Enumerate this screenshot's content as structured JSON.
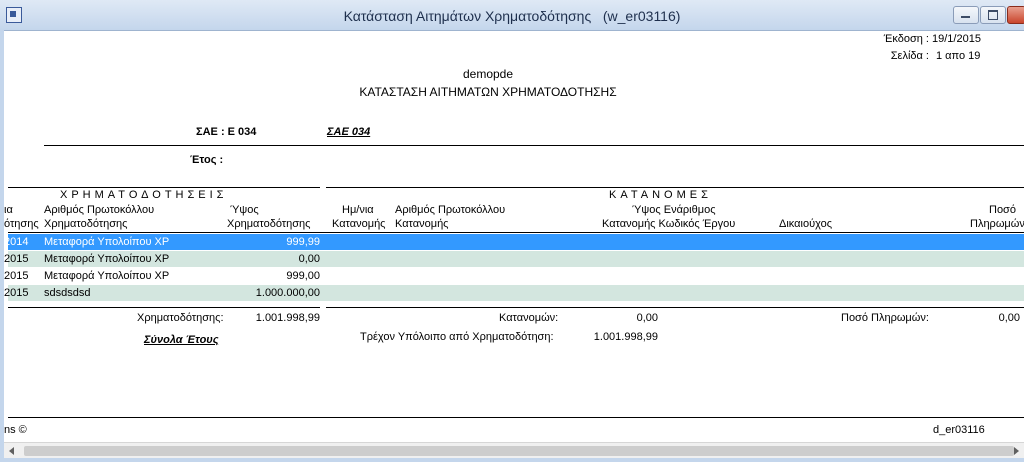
{
  "window": {
    "title": "Κατάσταση Αιτημάτων Χρηματοδότησης   (w_er03116)"
  },
  "report": {
    "edition_label": "Έκδοση :",
    "edition_value": "19/1/2015",
    "page_label": "Σελίδα :",
    "page_value": "1 απο 19",
    "company": "demopde",
    "title": "ΚΑΤΑΣΤΑΣΗ ΑΙΤΗΜΑΤΩΝ ΧΡΗΜΑΤΟΔΟΤΗΣΗΣ",
    "sae_label": "ΣΑΕ : Ε 034",
    "sae_link": "ΣΑΕ 034",
    "year_label": "Έτος :"
  },
  "headers": {
    "funding_group": "ΧΡΗΜΑΤΟΔΟΤΗΣΕΙΣ",
    "allocation_group": "ΚΑΤΑΝΟΜΕΣ",
    "col_date_1": "ια",
    "col_date_2": "ότησης",
    "col_protocol_1": "Αριθμός Πρωτοκόλλου",
    "col_protocol_2": "Χρηματοδότησης",
    "col_amount_1": "Ύψος",
    "col_amount_2": "Χρηματοδότησης",
    "col_alloc_date_1": "Ημ/νια",
    "col_alloc_date_2": "Κατανομής",
    "col_alloc_protocol_1": "Αριθμός Πρωτοκόλλου",
    "col_alloc_protocol_2": "Κατανομής",
    "col_alloc_amount_1": "Ύψος Ενάριθμος",
    "col_alloc_amount_2": "Κατανομής Κωδικός Έργου",
    "col_beneficiary": "Δικαιούχος",
    "col_payment_1": "Ποσό",
    "col_payment_2": "Πληρωμών"
  },
  "rows": [
    {
      "date": "2014",
      "protocol": "Μεταφορά Υπολοίπου ΧΡ",
      "amount": "999,99"
    },
    {
      "date": "2015",
      "protocol": "Μεταφορά Υπολοίπου ΧΡ",
      "amount": "0,00"
    },
    {
      "date": "2015",
      "protocol": "Μεταφορά Υπολοίπου ΧΡ",
      "amount": "999,00"
    },
    {
      "date": "2015",
      "protocol": "sdsdsdsd",
      "amount": "1.000.000,00"
    }
  ],
  "totals": {
    "funding_label": "Χρηματοδότησης:",
    "funding_value": "1.001.998,99",
    "year_totals_label": "Σύνολα Έτους",
    "allocations_label": "Κατανομών:",
    "allocations_value": "0,00",
    "payments_label": "Ποσό Πληρωμών:",
    "payments_value": "0,00",
    "balance_label": "Τρέχον Υπόλοιπο από Χρηματοδότηση:",
    "balance_value": "1.001.998,99"
  },
  "footer": {
    "left": "ns ©",
    "right": "d_er03116"
  }
}
